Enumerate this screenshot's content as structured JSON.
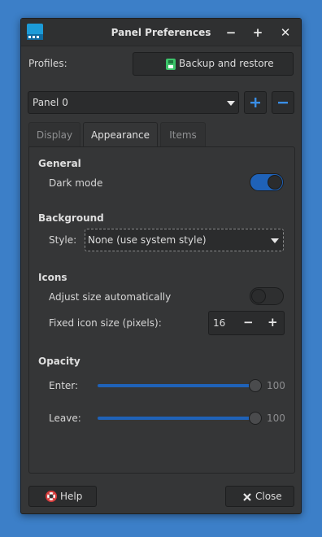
{
  "window": {
    "title": "Panel Preferences",
    "controls": {
      "minimize": "−",
      "maximize": "+",
      "close": "✕"
    }
  },
  "profiles": {
    "label": "Profiles:",
    "backup_button": "Backup and restore"
  },
  "panel_select": {
    "value": "Panel 0",
    "add_icon": "plus",
    "remove_icon": "minus"
  },
  "tabs": [
    {
      "label": "Display",
      "active": false
    },
    {
      "label": "Appearance",
      "active": true
    },
    {
      "label": "Items",
      "active": false
    }
  ],
  "general": {
    "title": "General",
    "dark_mode_label": "Dark mode",
    "dark_mode_on": true
  },
  "background": {
    "title": "Background",
    "style_label": "Style:",
    "style_value": "None (use system style)"
  },
  "icons": {
    "title": "Icons",
    "adjust_label": "Adjust size automatically",
    "adjust_on": false,
    "fixed_label": "Fixed icon size (pixels):",
    "fixed_value": "16",
    "minus": "−",
    "plus": "+"
  },
  "opacity": {
    "title": "Opacity",
    "enter_label": "Enter:",
    "enter_value": "100",
    "leave_label": "Leave:",
    "leave_value": "100"
  },
  "footer": {
    "help_label": "Help",
    "close_label": "Close"
  },
  "colors": {
    "desktop": "#3c7fc8",
    "window_bg": "#353637",
    "accent": "#1f62b8",
    "plus_minus_icon": "#3a8ee6"
  }
}
